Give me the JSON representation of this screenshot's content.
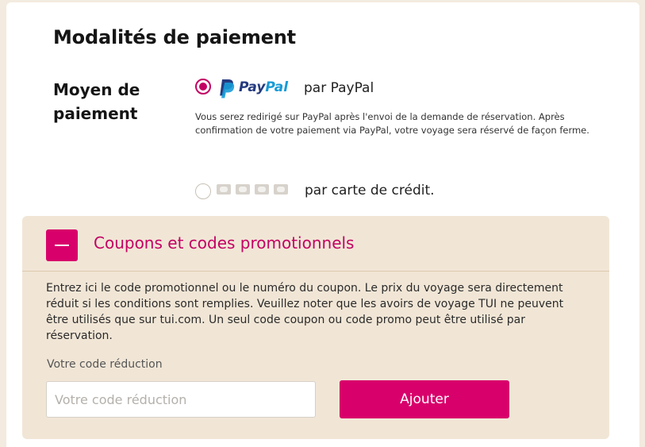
{
  "section": {
    "title": "Modalités de paiement"
  },
  "payment_method": {
    "label": "Moyen de paiement",
    "options": [
      {
        "id": "paypal",
        "selected": true,
        "logo_text_part1": "Pay",
        "logo_text_part2": "Pal",
        "label": "par PayPal",
        "description": "Vous serez redirigé sur PayPal après l'envoi de la demande de réservation. Après confirmation de votre paiement via PayPal, votre voyage sera réservé de façon ferme."
      },
      {
        "id": "credit-card",
        "selected": false,
        "label": "par carte de crédit.",
        "card_icons": [
          "visa-card-icon",
          "mastercard-card-icon",
          "amex-card-icon",
          "diners-card-icon"
        ]
      }
    ]
  },
  "promo": {
    "title": "Coupons et codes promotionnels",
    "description": "Entrez ici le code promotionnel ou le numéro du coupon. Le prix du voyage sera directement réduit si les conditions sont remplies. Veuillez noter que les avoirs de voyage TUI ne peuvent être utilisés que sur tui.com. Un seul code coupon ou code promo peut être utilisé par réservation.",
    "field_label": "Votre code réduction",
    "field_placeholder": "Votre code réduction",
    "field_value": "",
    "add_button": "Ajouter",
    "toggle_icon": "minus-icon"
  },
  "colors": {
    "accent": "#d8006b",
    "accent_text": "#c30063",
    "panel_bg": "#f1e6d6",
    "page_bg": "#f3ebdf",
    "paypal_dark": "#253b80",
    "paypal_light": "#179bd7"
  }
}
